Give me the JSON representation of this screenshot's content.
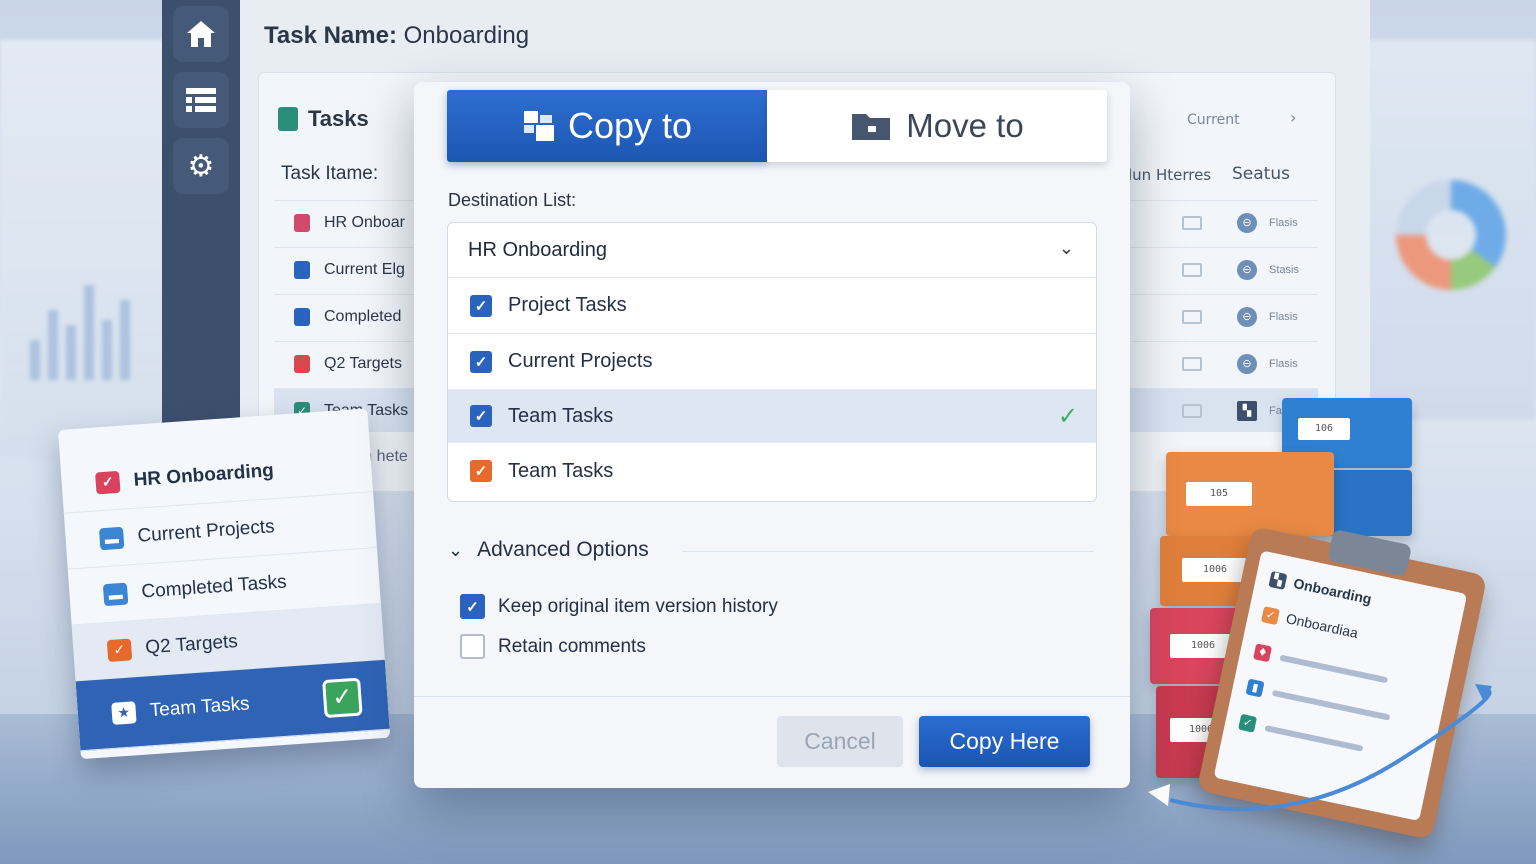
{
  "page": {
    "task_name_label": "Task Name:",
    "task_name_value": "Onboarding"
  },
  "sidebar": {
    "items": [
      {
        "icon": "home-icon"
      },
      {
        "icon": "list-icon"
      },
      {
        "icon": "gear-icon"
      }
    ]
  },
  "table": {
    "heading": "Tasks",
    "current_link": "Current",
    "columns": {
      "task": "Task Itame:",
      "items": "lun Hterres",
      "status": "Seatus"
    },
    "rows": [
      {
        "label": "HR Onboar",
        "icon_color": "#d04a6a",
        "status": "Flasis"
      },
      {
        "label": "Current Elg",
        "icon_color": "#2a63be",
        "status": "Stasis"
      },
      {
        "label": "Completed",
        "icon_color": "#2a63be",
        "status": "Flasis"
      },
      {
        "label": "Q2 Targets",
        "icon_color": "#d9474f",
        "status": "Flasis"
      },
      {
        "label": "Team Tasks",
        "icon_color": "#2a8f7a",
        "status": "Fa"
      },
      {
        "label": "om hete",
        "icon_color": "",
        "status": ""
      }
    ]
  },
  "float_card": {
    "items": [
      {
        "label": "HR Onboarding",
        "icon_color": "#d9435d",
        "glyph": "✓"
      },
      {
        "label": "Current Projects",
        "icon_color": "#3a86d4",
        "glyph": "▬"
      },
      {
        "label": "Completed Tasks",
        "icon_color": "#3a86d4",
        "glyph": "▬"
      },
      {
        "label": "Q2 Targets",
        "icon_color": "#e56a2c",
        "glyph": "✓"
      },
      {
        "label": "Team Tasks",
        "icon_color": "#ffffff",
        "glyph": "★"
      }
    ]
  },
  "dialog": {
    "tab_copy": "Copy to",
    "tab_move": "Move to",
    "destination_label": "Destination List:",
    "selected_list": "HR Onboarding",
    "options": [
      {
        "label": "Project Tasks",
        "checkbox": "blue",
        "highlighted": false
      },
      {
        "label": "Current Projects",
        "checkbox": "blue",
        "highlighted": false
      },
      {
        "label": "Team Tasks",
        "checkbox": "blue",
        "highlighted": true
      },
      {
        "label": "Team Tasks",
        "checkbox": "orange",
        "highlighted": false
      }
    ],
    "advanced_label": "Advanced Options",
    "keep_history_label": "Keep original item version history",
    "keep_history_checked": true,
    "retain_comments_label": "Retain comments",
    "retain_comments_checked": false,
    "cancel_label": "Cancel",
    "copy_here_label": "Copy Here"
  },
  "illustration": {
    "box_labels": [
      "106",
      "105",
      "1006",
      "1006",
      "1006"
    ],
    "clipboard_title": "Onboarding",
    "clipboard_sub": "Onboardiaa"
  },
  "colors": {
    "accent": "#1d56b3",
    "sidebar": "#3c4f6c",
    "success": "#3fae5a"
  }
}
